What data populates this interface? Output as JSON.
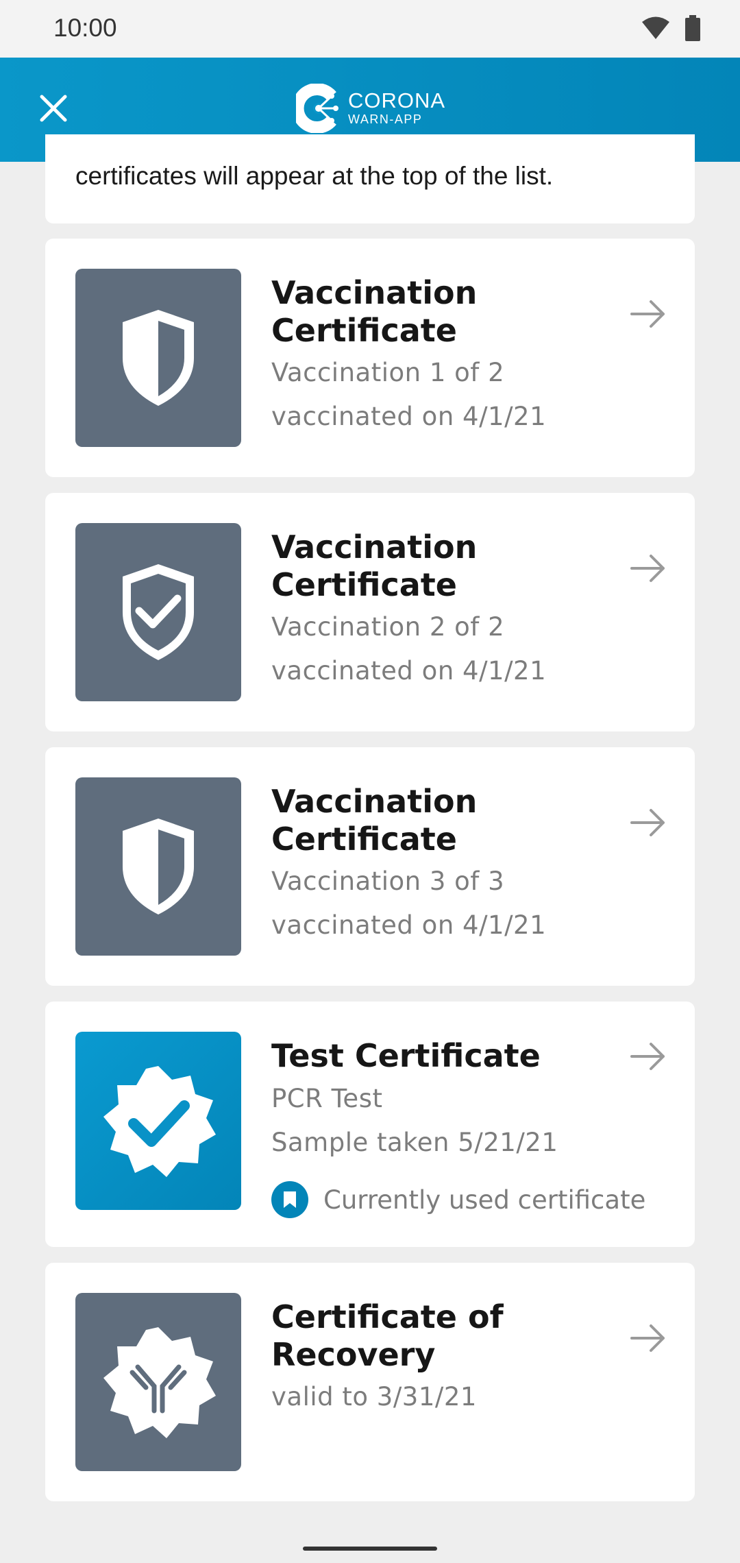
{
  "status_bar": {
    "time": "10:00"
  },
  "app_bar": {
    "brand_line1": "CORONA",
    "brand_line2": "WARN-APP"
  },
  "intro": {
    "text": "certificates will appear at the top of the list."
  },
  "certificates": [
    {
      "title": "Vaccination Certificate",
      "line1": "Vaccination 1 of 2",
      "line2": "vaccinated on 4/1/21",
      "icon": "shield-half-icon"
    },
    {
      "title": "Vaccination Certificate",
      "line1": "Vaccination 2 of 2",
      "line2": "vaccinated on 4/1/21",
      "icon": "shield-check-icon"
    },
    {
      "title": "Vaccination Certificate",
      "line1": "Vaccination 3 of 3",
      "line2": "vaccinated on 4/1/21",
      "icon": "shield-half-icon"
    },
    {
      "title": "Test Certificate",
      "line1": "PCR Test",
      "line2": "Sample taken 5/21/21",
      "badge": "Currently used certificate",
      "icon": "badge-check-icon"
    },
    {
      "title": "Certificate of Recovery",
      "line1": "valid to 3/31/21",
      "icon": "antibody-icon"
    }
  ],
  "colors": {
    "app_bar": "#0a97c9",
    "thumb_gray": "#5f6d7d",
    "accent": "#0385b8"
  }
}
